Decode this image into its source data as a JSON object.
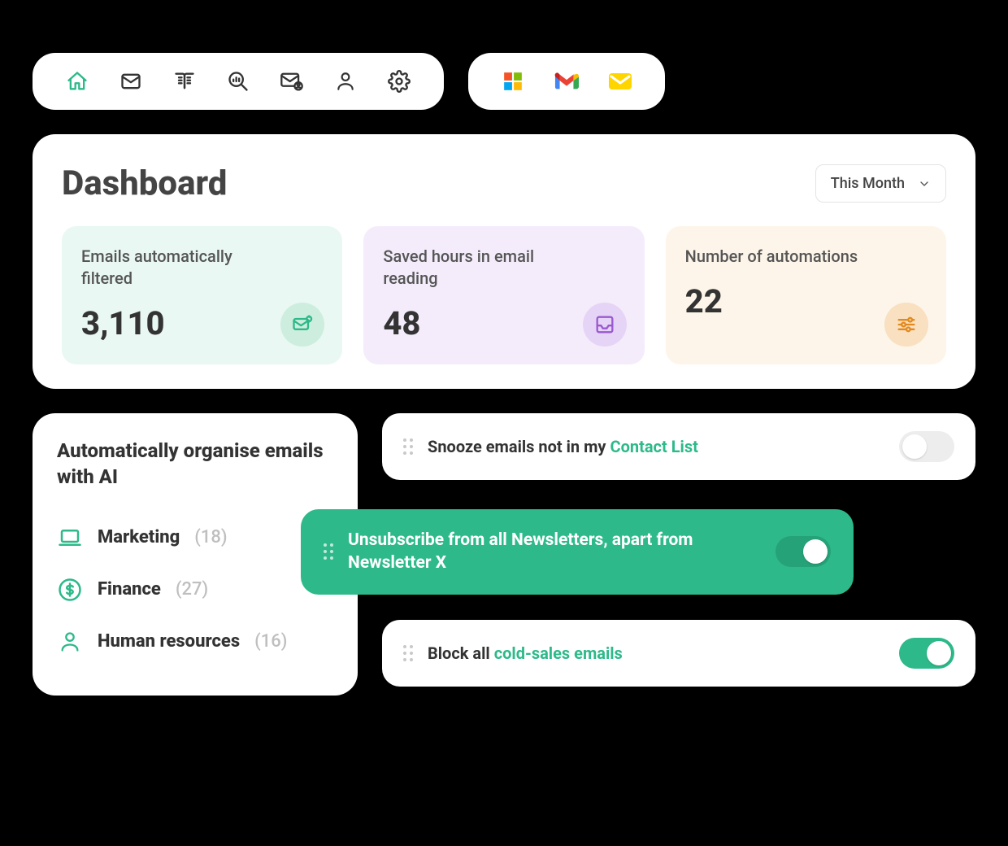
{
  "colors": {
    "accent": "#2db98a"
  },
  "toolbar1": {
    "icons": [
      "home",
      "mail",
      "book",
      "search-analytics",
      "mail-user",
      "user",
      "gear"
    ]
  },
  "toolbar2": {
    "icons": [
      "microsoft",
      "gmail",
      "mail-yellow"
    ]
  },
  "dashboard": {
    "title": "Dashboard",
    "period": "This Month",
    "stats": [
      {
        "label": "Emails automatically filtered",
        "value": "3,110",
        "icon": "mail-filter"
      },
      {
        "label": "Saved hours in email reading",
        "value": "48",
        "icon": "inbox"
      },
      {
        "label": "Number of automations",
        "value": "22",
        "icon": "sliders"
      }
    ]
  },
  "categories": {
    "title": "Automatically organise emails with AI",
    "items": [
      {
        "icon": "laptop",
        "name": "Marketing",
        "count": "(18)"
      },
      {
        "icon": "dollar",
        "name": "Finance",
        "count": "(27)"
      },
      {
        "icon": "person",
        "name": "Human resources",
        "count": "(16)"
      }
    ]
  },
  "rules": [
    {
      "text_pre": "Snooze emails not in my ",
      "highlight": "Contact List",
      "text_post": "",
      "on": false
    },
    {
      "text_pre": "Unsubscribe from all Newsletters, apart from Newsletter X",
      "highlight": "",
      "text_post": "",
      "on": true,
      "featured": true
    },
    {
      "text_pre": "Block all ",
      "highlight": "cold-sales emails",
      "text_post": "",
      "on": true
    }
  ]
}
